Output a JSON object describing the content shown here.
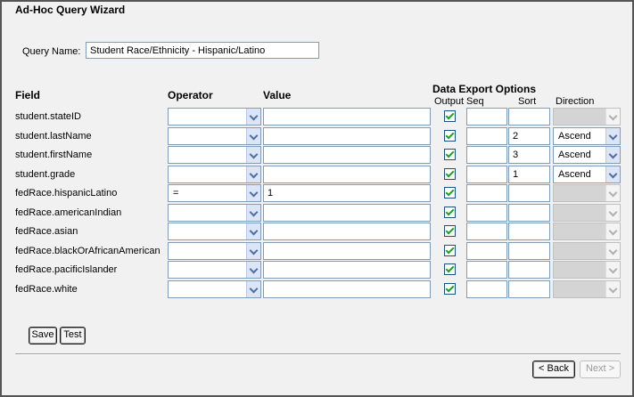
{
  "title": "Ad-Hoc Query Wizard",
  "query_name": {
    "label": "Query Name:",
    "value": "Student Race/Ethnicity - Hispanic/Latino"
  },
  "headers": {
    "field": "Field",
    "operator": "Operator",
    "value": "Value",
    "export_options": "Data Export Options",
    "output": "Output",
    "seq": "Seq",
    "sort": "Sort",
    "direction": "Direction"
  },
  "rows": [
    {
      "field": "student.stateID",
      "operator": "",
      "value": "",
      "output": true,
      "seq": "",
      "sort": "",
      "direction": "",
      "direction_enabled": false
    },
    {
      "field": "student.lastName",
      "operator": "",
      "value": "",
      "output": true,
      "seq": "",
      "sort": "2",
      "direction": "Ascend",
      "direction_enabled": true
    },
    {
      "field": "student.firstName",
      "operator": "",
      "value": "",
      "output": true,
      "seq": "",
      "sort": "3",
      "direction": "Ascend",
      "direction_enabled": true
    },
    {
      "field": "student.grade",
      "operator": "",
      "value": "",
      "output": true,
      "seq": "",
      "sort": "1",
      "direction": "Ascend",
      "direction_enabled": true
    },
    {
      "field": "fedRace.hispanicLatino",
      "operator": "=",
      "value": "1",
      "output": true,
      "seq": "",
      "sort": "",
      "direction": "",
      "direction_enabled": false
    },
    {
      "field": "fedRace.americanIndian",
      "operator": "",
      "value": "",
      "output": true,
      "seq": "",
      "sort": "",
      "direction": "",
      "direction_enabled": false
    },
    {
      "field": "fedRace.asian",
      "operator": "",
      "value": "",
      "output": true,
      "seq": "",
      "sort": "",
      "direction": "",
      "direction_enabled": false
    },
    {
      "field": "fedRace.blackOrAfricanAmerican",
      "operator": "",
      "value": "",
      "output": true,
      "seq": "",
      "sort": "",
      "direction": "",
      "direction_enabled": false
    },
    {
      "field": "fedRace.pacificIslander",
      "operator": "",
      "value": "",
      "output": true,
      "seq": "",
      "sort": "",
      "direction": "",
      "direction_enabled": false
    },
    {
      "field": "fedRace.white",
      "operator": "",
      "value": "",
      "output": true,
      "seq": "",
      "sort": "",
      "direction": "",
      "direction_enabled": false
    }
  ],
  "buttons": {
    "save": "Save",
    "test": "Test",
    "back": "< Back",
    "next": "Next >"
  }
}
